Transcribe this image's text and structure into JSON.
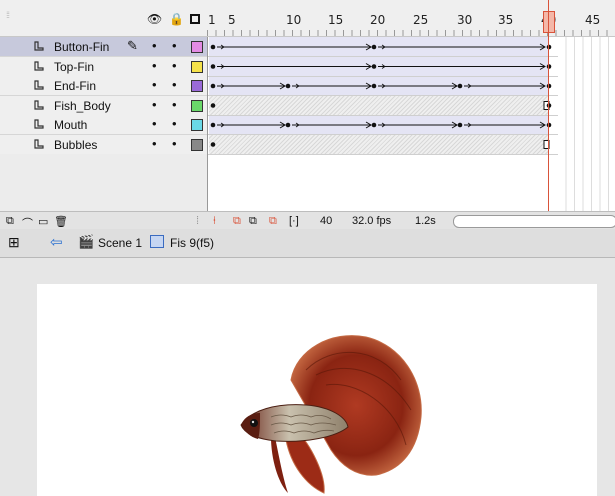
{
  "timeline": {
    "frame_numbers": [
      "1",
      "5",
      "10",
      "15",
      "20",
      "25",
      "30",
      "35",
      "40",
      "45"
    ],
    "current_frame": "40",
    "fps": "32.0 fps",
    "elapsed": "1.2s",
    "layers": [
      {
        "name": "Button-Fin",
        "color": "#e38be3",
        "selected": true,
        "type": "tween"
      },
      {
        "name": "Top-Fin",
        "color": "#f5e24a",
        "selected": false,
        "type": "tween"
      },
      {
        "name": "End-Fin",
        "color": "#9a6ad8",
        "selected": false,
        "type": "tween"
      },
      {
        "name": "Fish_Body",
        "color": "#6ad86a",
        "selected": false,
        "type": "static"
      },
      {
        "name": "Mouth",
        "color": "#6ad8e6",
        "selected": false,
        "type": "tween"
      },
      {
        "name": "Bubbles",
        "color": "#888888",
        "selected": false,
        "type": "static"
      }
    ]
  },
  "editbar": {
    "scene_label": "Scene 1",
    "symbol_label": "Fis 9(f5)"
  }
}
